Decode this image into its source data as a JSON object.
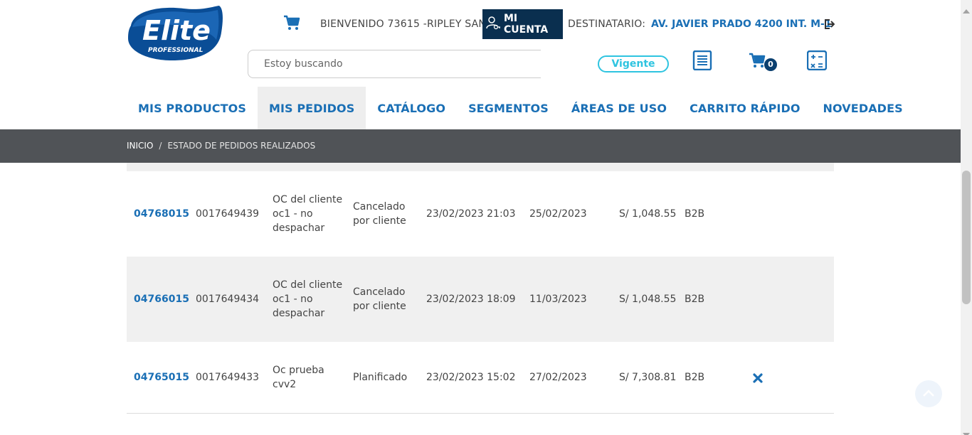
{
  "header": {
    "logo_text": "Elite",
    "logo_subtext": "PROFESSIONAL",
    "welcome_text": "BIENVENIDO 73615 -RIPLEY SAN",
    "account_button": "MI CUENTA",
    "recipient_label": "DESTINATARIO:",
    "recipient_value": "AV. JAVIER PRADO 4200 INT. M-1",
    "search_placeholder": "Estoy buscando",
    "status_badge": "Vigente",
    "cart_count": "0"
  },
  "nav": {
    "items": [
      "MIS PRODUCTOS",
      "MIS PEDIDOS",
      "CATÁLOGO",
      "SEGMENTOS",
      "ÁREAS DE USO",
      "CARRITO RÁPIDO",
      "NOVEDADES"
    ],
    "active": "MIS PEDIDOS"
  },
  "breadcrumb": {
    "home": "INICIO",
    "separator": "/",
    "current": "ESTADO DE PEDIDOS REALIZADOS"
  },
  "orders": [
    {
      "order_number": "04768015",
      "doc_number": "0017649439",
      "reference": [
        "OC del cliente",
        "oc1 - no",
        "despachar"
      ],
      "status": [
        "Cancelado",
        "por cliente"
      ],
      "created": "23/02/2023 21:03",
      "delivery": "25/02/2023",
      "amount": "S/ 1,048.55",
      "channel": "B2B",
      "cancellable": false
    },
    {
      "order_number": "04766015",
      "doc_number": "0017649434",
      "reference": [
        "OC del cliente",
        "oc1 - no",
        "despachar"
      ],
      "status": [
        "Cancelado",
        "por cliente"
      ],
      "created": "23/02/2023 18:09",
      "delivery": "11/03/2023",
      "amount": "S/ 1,048.55",
      "channel": "B2B",
      "cancellable": false
    },
    {
      "order_number": "04765015",
      "doc_number": "0017649433",
      "reference": [
        "Oc prueba",
        "cvv2"
      ],
      "status": [
        "Planificado"
      ],
      "created": "23/02/2023 15:02",
      "delivery": "27/02/2023",
      "amount": "S/ 7,308.81",
      "channel": "B2B",
      "cancellable": true
    }
  ],
  "colors": {
    "brand_blue": "#1a6fb5",
    "account_bg": "#0a2f4f",
    "breadcrumb_bg": "#505357",
    "status_badge": "#2ec4e0",
    "row_alt": "#f0f0f0"
  },
  "icons": {
    "top_cart": "cart-icon",
    "account": "user-key-icon",
    "logout": "logout-icon",
    "order_list": "list-icon",
    "cart": "cart-icon",
    "calculator": "calculator-icon",
    "cancel_order": "close-icon",
    "back_to_top": "arrow-up-icon"
  }
}
